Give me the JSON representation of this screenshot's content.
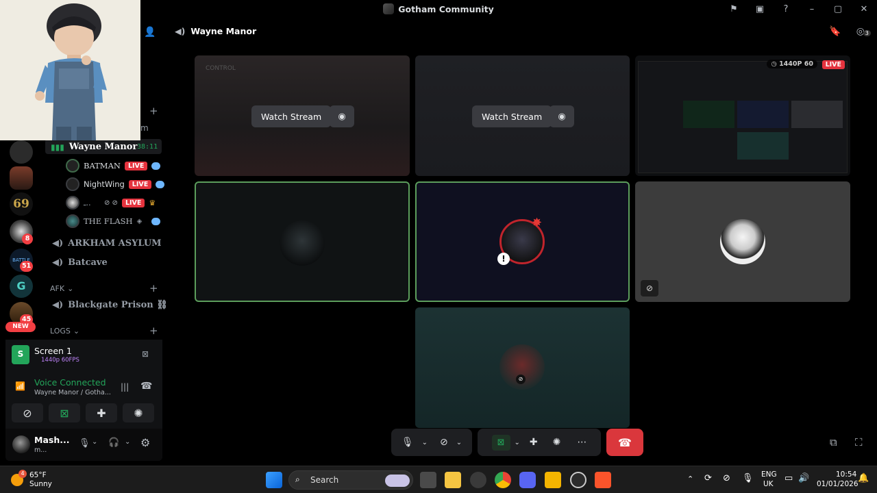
{
  "window": {
    "title": "Gotham Community"
  },
  "sidebar": {
    "active_channel": {
      "name": "Wayne Manor",
      "time": "38:11"
    },
    "voice_users": [
      {
        "name": "BATMAN",
        "live": "LIVE"
      },
      {
        "name": "NightWing",
        "live": "LIVE"
      },
      {
        "name": "ـ..",
        "live": "LIVE"
      },
      {
        "name": "THE FLASH",
        "live": ""
      }
    ],
    "channels": [
      {
        "name": "ARKHAM ASYLUM"
      },
      {
        "name": "Batcave"
      }
    ],
    "afk_category": "AFK",
    "afk_channel": "Blackgate Prison ⛓",
    "logs_category": "LOGS",
    "partial_channel_char": "m",
    "new_badge": "NEW"
  },
  "rail": {
    "badges": [
      "8",
      "51",
      "45"
    ],
    "server_text": "69"
  },
  "panel": {
    "screen_title": "Screen 1",
    "screen_sub": "1440p 60FPS",
    "voice_status": "Voice Connected",
    "voice_location": "Wayne Manor / Gotha...",
    "user_name": "Mash...",
    "user_status": "m..."
  },
  "stage": {
    "header": "Wayne Manor",
    "inbox_count": "3",
    "watch_label": "Watch Stream",
    "stream_quality": "1440P 60",
    "live_label": "LIVE",
    "tile1_text": "CONTROL"
  },
  "taskbar": {
    "weather_temp": "65°F",
    "weather_desc": "Sunny",
    "weather_badge": "4",
    "search": "Search",
    "lang": "ENG",
    "region": "UK",
    "time": "10:54",
    "date": "01/01/2026"
  }
}
